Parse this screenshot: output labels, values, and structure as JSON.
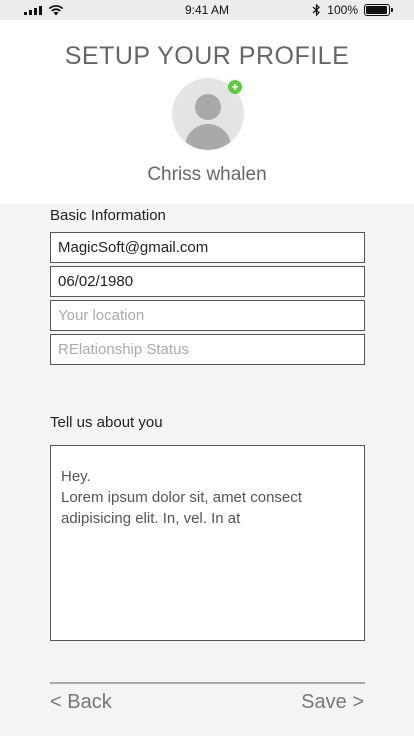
{
  "status_bar": {
    "time": "9:41 AM",
    "battery_percent": "100%",
    "battery_level": 1.0
  },
  "header": {
    "title": "SETUP YOUR PROFILE",
    "name": "Chriss whalen",
    "avatar_icon": "user-placeholder-icon",
    "add_badge_symbol": "+",
    "add_badge_color": "#5ccc3a"
  },
  "basic_info": {
    "label": "Basic Information",
    "email": "MagicSoft@gmail.com",
    "dob": "06/02/1980",
    "location_placeholder": "Your location",
    "relationship_placeholder": "RElationship Status"
  },
  "about": {
    "label": "Tell us about you",
    "text": "Hey.\nLorem ipsum dolor sit, amet consect adipisicing elit. In, vel. In at"
  },
  "nav": {
    "back_label": "< Back",
    "save_label": "Save >"
  }
}
